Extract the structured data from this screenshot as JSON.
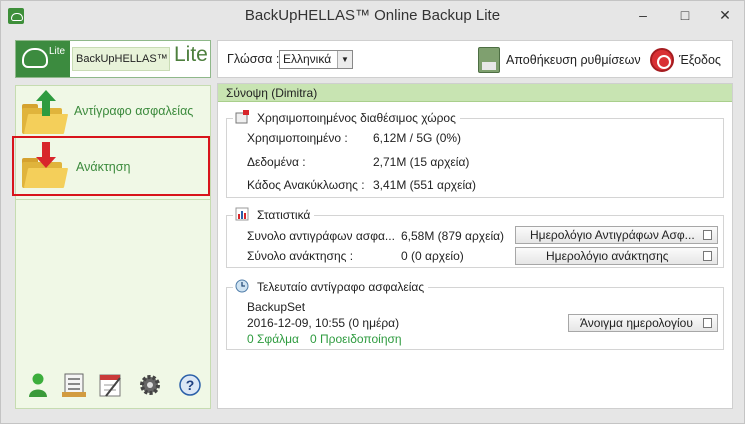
{
  "window": {
    "title": "BackUpHELLAS™ Online Backup Lite",
    "minimize": "–",
    "maximize": "□",
    "close": "✕"
  },
  "logo": {
    "brand": "BackUpHELLAS™",
    "lite": "Lite",
    "lite_small": "Lite"
  },
  "nav": [
    {
      "label": "Αντίγραφο ασφαλείας",
      "icon": "backup-folder-icon",
      "arrow_color": "#2e9b3f"
    },
    {
      "label": "Ανάκτηση",
      "icon": "restore-folder-icon",
      "arrow_color": "#d8262b",
      "highlighted": true
    }
  ],
  "bottom_icons": [
    "user-icon",
    "report-icon",
    "schedule-icon",
    "settings-gear-icon",
    "help-icon"
  ],
  "toolbar": {
    "language_label": "Γλώσσα :",
    "language_value": "Ελληνικά",
    "save_label": "Αποθήκευση ρυθμίσεων",
    "exit_label": "Έξοδος"
  },
  "summary": {
    "header": "Σύνοψη (Dimitra)",
    "space": {
      "title": "Χρησιμοποιημένος διαθέσιμος χώρος",
      "rows": [
        {
          "label": "Χρησιμοποιημένο :",
          "value": "6,12M / 5G (0%)"
        },
        {
          "label": "Δεδομένα :",
          "value": "2,71M  (15 αρχεία)"
        },
        {
          "label": "Κάδος Ανακύκλωσης :",
          "value": "3,41M  (551 αρχεία)"
        }
      ]
    },
    "stats": {
      "title": "Στατιστικά",
      "rows": [
        {
          "label": "Συνολο αντιγράφων ασφα...",
          "value": "6,58M  (879 αρχεία)",
          "button": "Ημερολόγιο Αντιγράφων Ασφ..."
        },
        {
          "label": "Σύνολο ανάκτησης :",
          "value": "0  (0 αρχείο)",
          "button": "Ημερολόγιο ανάκτησης"
        }
      ]
    },
    "last_backup": {
      "title": "Τελευταίο αντίγραφο ασφαλείας",
      "set": "BackupSet",
      "datetime": "2016-12-09, 10:55 (0 ημέρα)",
      "errors": "0 Σφάλμα",
      "warnings": "0 Προειδοποίηση",
      "open_log": "Άνοιγμα ημερολογίου"
    }
  },
  "colors": {
    "accent_green": "#3c8b3f",
    "header_green": "#c8e4b2",
    "highlight_red": "#d8141b"
  }
}
